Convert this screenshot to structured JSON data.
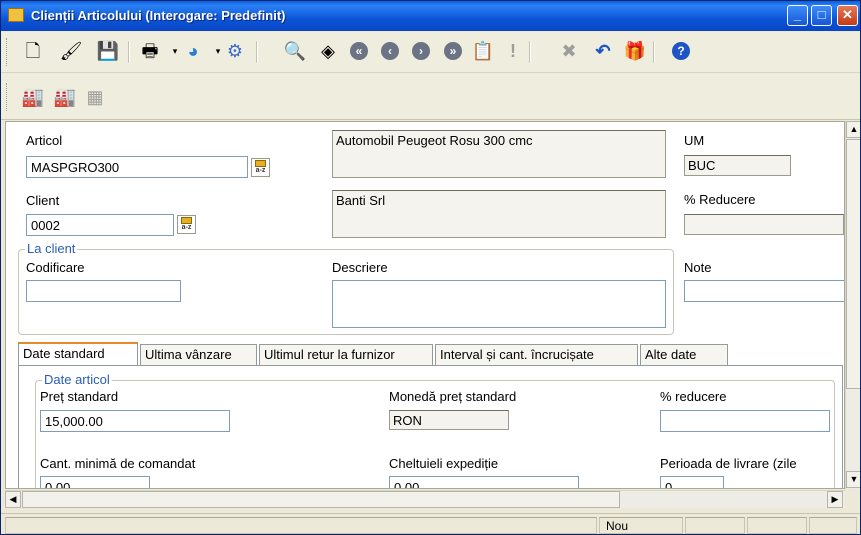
{
  "window": {
    "title": "Clienții Articolului (Interogare: Predefinit)",
    "minimize": "_",
    "maximize": "□",
    "close": "✕"
  },
  "toolbar": {
    "icons": [
      "new-document",
      "edit",
      "save",
      "print",
      "find-dropdown",
      "query-options",
      "search",
      "binoculars",
      "first-record",
      "previous-record",
      "next-record",
      "last-record",
      "copy",
      "exclamation",
      "delete",
      "undo",
      "filter-gift",
      "help"
    ],
    "help_label": "?"
  },
  "toolbar2": {
    "icons": [
      "warehouse-1",
      "warehouse-2",
      "translate"
    ]
  },
  "form": {
    "articol_label": "Articol",
    "articol_value": "MASPGRO300",
    "articol_desc": "Automobil Peugeot Rosu 300 cmc",
    "um_label": "UM",
    "um_value": "BUC",
    "client_label": "Client",
    "client_value": "0002",
    "client_desc": "Banti Srl",
    "reducere_label": "% Reducere",
    "reducere_value": "",
    "lookup_text": "a-z"
  },
  "la_client": {
    "legend": "La client",
    "codificare_label": "Codificare",
    "codificare_value": "",
    "descriere_label": "Descriere",
    "descriere_value": "",
    "note_label": "Note",
    "note_value": ""
  },
  "tabs": [
    {
      "label": "Date standard",
      "active": true
    },
    {
      "label": "Ultima vânzare",
      "active": false
    },
    {
      "label": "Ultimul retur la furnizor",
      "active": false
    },
    {
      "label": "Interval și cant. încrucișate",
      "active": false
    },
    {
      "label": "Alte date",
      "active": false
    }
  ],
  "date_articol": {
    "legend": "Date articol",
    "pret_label": "Preț standard",
    "pret_value": "15,000.00",
    "moneda_label": "Monedă preț standard",
    "moneda_value": "RON",
    "reducere_label": "% reducere",
    "reducere_value": "",
    "cant_label": "Cant. minimă de comandat",
    "cant_value": "0.00",
    "cheltuieli_label": "Cheltuieli expediție",
    "cheltuieli_value": "0.00",
    "perioada_label": "Perioada de livrare (zile",
    "perioada_value": "0"
  },
  "status": {
    "mode": "Nou"
  }
}
